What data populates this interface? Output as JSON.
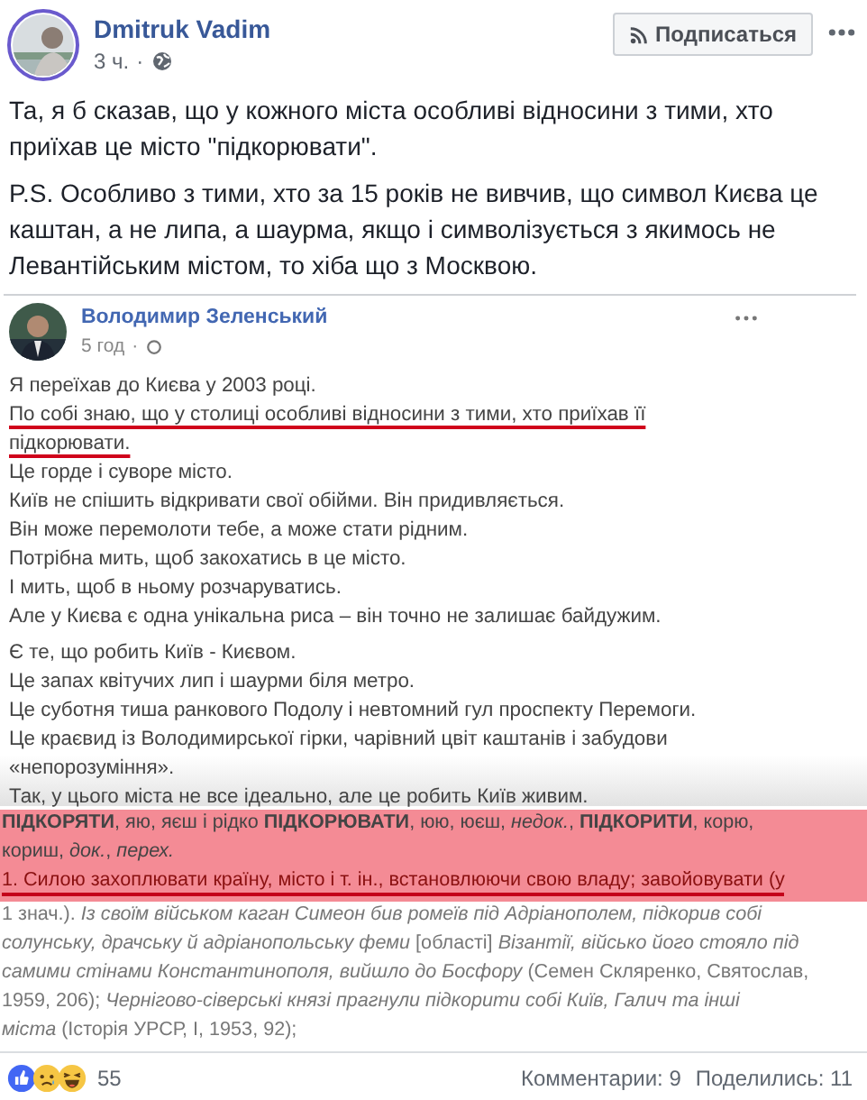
{
  "post": {
    "author": "Dmitruk Vadim",
    "time": "3 ч.",
    "separator": "·",
    "subscribe_label": "Подписаться",
    "paragraphs": [
      "Та, я б сказав, що у кожного міста особливі відносини з тими, хто приїхав це місто \"підкорювати\".",
      "P.S. Особливо з тими, хто за 15 років не вивчив, що символ Києва це каштан, а не липа, а шаурма, якщо і символізується з якимось не Левантійським містом, то хіба що з Москвою."
    ]
  },
  "shared_screenshot": {
    "author": "Володимир Зеленський",
    "time": "5 год",
    "separator": "·",
    "paragraphs": [
      [
        {
          "text": "Я переїхав до Києва у 2003 році.",
          "underlined": false
        },
        {
          "text": "По собі знаю, що у столиці особливі відносини з тими, хто приїхав її",
          "underlined": true
        },
        {
          "text": "підкорювати.",
          "underlined": true
        },
        {
          "text": "Це горде і суворе місто.",
          "underlined": false
        },
        {
          "text": "Київ не спішить відкривати свої обійми. Він придивляється.",
          "underlined": false
        },
        {
          "text": "Він може перемолоти тебе, а може стати рідним.",
          "underlined": false
        },
        {
          "text": "Потрібна мить, щоб закохатись в це місто.",
          "underlined": false
        },
        {
          "text": "І мить, щоб в ньому розчаруватись.",
          "underlined": false
        },
        {
          "text": "Але у Києва є одна унікальна риса – він точно не залишає байдужим.",
          "underlined": false
        }
      ],
      [
        {
          "text": "Є те, що робить Київ - Києвом.",
          "underlined": false
        },
        {
          "text": "Це запах квітучих лип і шаурми біля метро.",
          "underlined": false
        },
        {
          "text": "Це суботня тиша ранкового Подолу і невтомний гул проспекту Перемоги.",
          "underlined": false
        },
        {
          "text": "Це краєвид із Володимирської гірки, чарівний цвіт каштанів і забудови",
          "underlined": false
        },
        {
          "text": "«непорозуміння».",
          "underlined": false
        },
        {
          "text": "Так, у цього міста не все ідеально, але це робить Київ живим.",
          "underlined": false
        }
      ]
    ]
  },
  "dictionary_excerpt": {
    "lines": [
      {
        "kind": "head",
        "highlighted": true,
        "underlined": false,
        "text": "**ПІДКОРЯТИ**, яю, яєш і рідко **ПІДКОРЮВАТИ**, юю, юєш, *недок.*, **ПІДКОРИТИ**, корю,"
      },
      {
        "kind": "head",
        "highlighted": true,
        "underlined": false,
        "text": "кориш, *док.*, *перех.*"
      },
      {
        "kind": "sense",
        "highlighted": true,
        "underlined": true,
        "text": "1. Силою захоплювати країну, місто і т. ін., встановлюючи свою владу; завойовувати (у"
      },
      {
        "kind": "quote",
        "highlighted": false,
        "underlined": false,
        "text": "1 знач.).   *Із своїм військом каган Симеон бив ромеїв під Адріанополем, підкорив собі*"
      },
      {
        "kind": "quote",
        "highlighted": false,
        "underlined": false,
        "text": "*солунську, драчську й адріанопольську феми* [області] *Візантії, військо його стояло під*"
      },
      {
        "kind": "quote",
        "highlighted": false,
        "underlined": false,
        "text": "*самими стінами Константинополя, вийшло до Босфору* (Семен Скляренко, Святослав,"
      },
      {
        "kind": "quote",
        "highlighted": false,
        "underlined": false,
        "text": "1959, 206);   *Чернігово-сіверські князі прагнули підкорити собі Київ, Галич та інші*"
      },
      {
        "kind": "quote",
        "highlighted": false,
        "underlined": false,
        "text": "*міста* (Історія УРСР, I, 1953, 92);"
      }
    ]
  },
  "footer": {
    "reaction_count": "55",
    "comments": "Комментарии: 9",
    "shares": "Поделились: 11"
  }
}
